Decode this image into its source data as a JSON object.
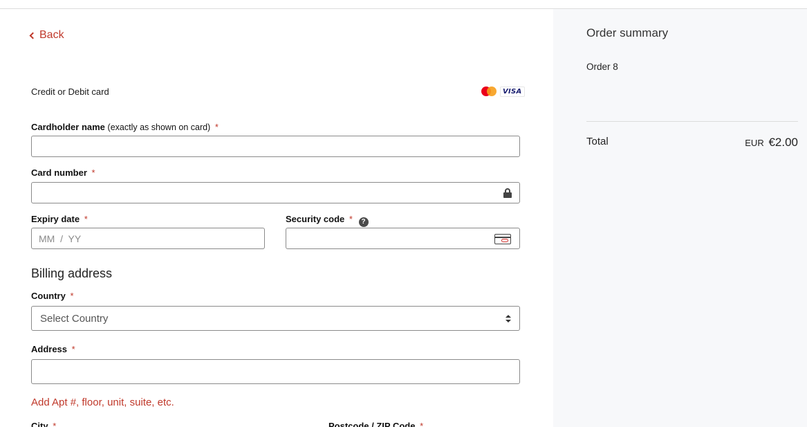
{
  "navigation": {
    "back_label": "Back"
  },
  "payment": {
    "method_label": "Credit or Debit card",
    "brands": [
      "Mastercard",
      "VISA"
    ],
    "visa_text": "VISA",
    "cardholder": {
      "label": "Cardholder name",
      "note": "(exactly as shown on card)",
      "required_mark": "*",
      "value": ""
    },
    "card_number": {
      "label": "Card number",
      "required_mark": "*",
      "value": ""
    },
    "expiry": {
      "label": "Expiry date",
      "required_mark": "*",
      "placeholder": "MM  /  YY",
      "value": ""
    },
    "security_code": {
      "label": "Security code",
      "required_mark": "*",
      "help_glyph": "?",
      "value": ""
    }
  },
  "billing": {
    "title": "Billing address",
    "country": {
      "label": "Country",
      "required_mark": "*",
      "selected": "Select Country"
    },
    "address": {
      "label": "Address",
      "required_mark": "*",
      "value": ""
    },
    "add_apt_label": "Add Apt #, floor, unit, suite, etc.",
    "city_label": "City",
    "postal_label": "Postcode / ZIP Code",
    "required_mark": "*"
  },
  "summary": {
    "title": "Order summary",
    "order_name": "Order 8",
    "total_label": "Total",
    "total_currency": "EUR",
    "total_amount": "€2.00"
  },
  "icons": {
    "back": "chevron-left-icon",
    "lock": "lock-icon",
    "help": "question-circle-icon",
    "cvc": "card-cvc-icon",
    "select": "select-arrows-icon"
  },
  "colors": {
    "accent": "#c0392b",
    "sidebar_bg": "#f7f8fa",
    "border": "#8a8a8a"
  }
}
